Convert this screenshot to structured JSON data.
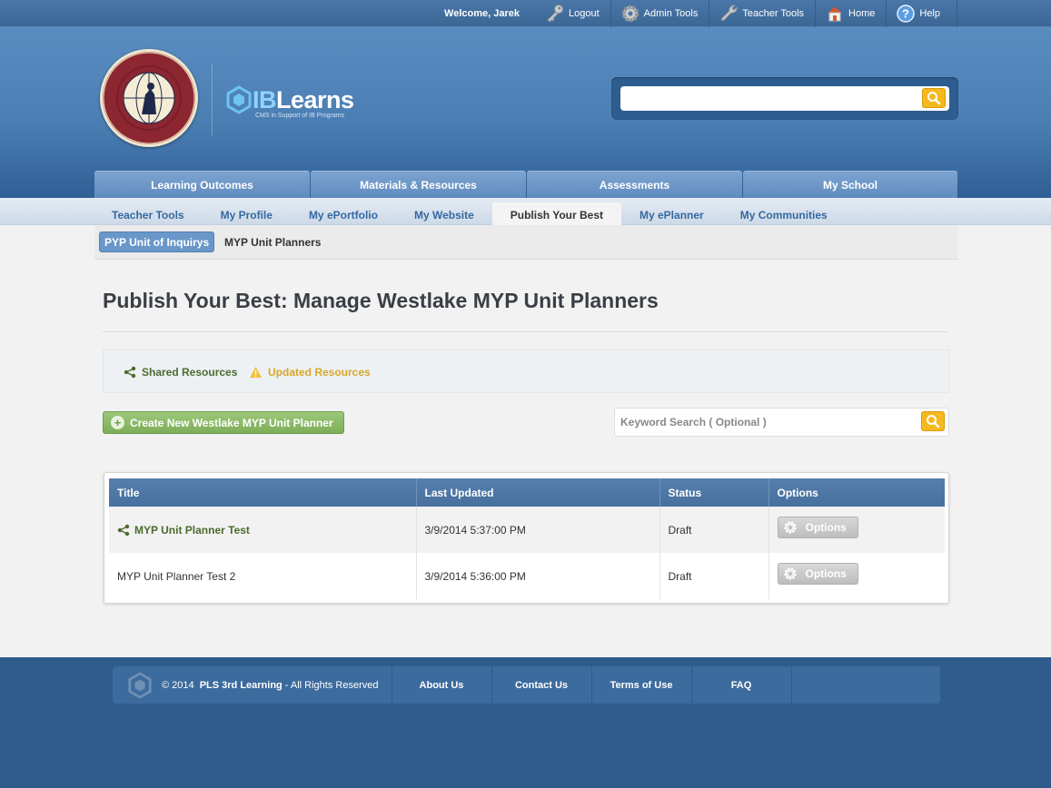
{
  "topbar": {
    "welcome": "Welcome, Jarek",
    "links": [
      {
        "label": "Logout",
        "icon": "key-icon"
      },
      {
        "label": "Admin Tools",
        "icon": "gear-icon"
      },
      {
        "label": "Teacher Tools",
        "icon": "wrench-icon"
      },
      {
        "label": "Home",
        "icon": "home-icon"
      },
      {
        "label": "Help",
        "icon": "help-icon"
      }
    ]
  },
  "header": {
    "logo_prefix": "IB",
    "logo_suffix": "Learns",
    "tagline": "CMS in Support of IB Programs",
    "search_placeholder": ""
  },
  "main_nav": [
    "Learning Outcomes",
    "Materials & Resources",
    "Assessments",
    "My School"
  ],
  "sub_nav": {
    "items": [
      "Teacher Tools",
      "My Profile",
      "My ePortfolio",
      "My Website",
      "Publish Your Best",
      "My ePlanner",
      "My Communities"
    ],
    "active": "Publish Your Best"
  },
  "tertiary_nav": {
    "active": "PYP Unit of Inquirys",
    "other": "MYP Unit Planners"
  },
  "page": {
    "title": "Publish Your Best: Manage Westlake MYP Unit Planners",
    "legend_shared": "Shared Resources",
    "legend_updated": "Updated Resources",
    "create_button": "Create New Westlake MYP Unit Planner",
    "keyword_placeholder": "Keyword Search ( Optional )"
  },
  "table": {
    "headers": [
      "Title",
      "Last Updated",
      "Status",
      "Options"
    ],
    "rows": [
      {
        "title": "MYP Unit Planner Test",
        "shared": true,
        "updated": "3/9/2014 5:37:00 PM",
        "status": "Draft",
        "options": "Options"
      },
      {
        "title": "MYP Unit Planner Test 2",
        "shared": false,
        "updated": "3/9/2014 5:36:00 PM",
        "status": "Draft",
        "options": "Options"
      }
    ]
  },
  "footer": {
    "copyright_prefix": "© 2014",
    "copyright_company": "PLS 3rd Learning",
    "copyright_suffix": "- All Rights Reserved",
    "links": [
      "About Us",
      "Contact Us",
      "Terms of Use",
      "FAQ"
    ]
  },
  "colors": {
    "header_blue": "#4b7fb4",
    "footer_blue": "#2f5c8d",
    "accent_yellow": "#f5b81e",
    "create_green": "#8bba66",
    "shared_green": "#4b6b2e",
    "updated_amber": "#d9a72a"
  }
}
